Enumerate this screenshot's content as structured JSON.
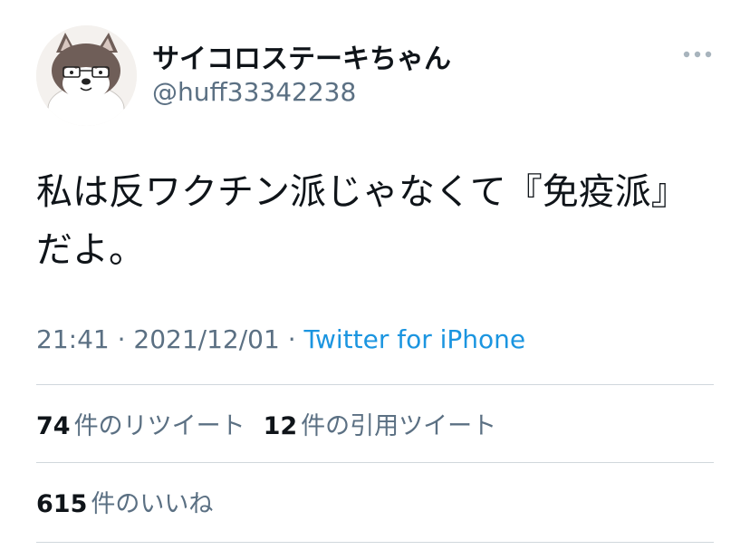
{
  "author": {
    "display_name": "サイコロステーキちゃん",
    "handle": "@huff33342238",
    "avatar_icon": "shiba-dog-with-glasses-avatar"
  },
  "tweet": {
    "text": "私は反ワクチン派じゃなくて『免疫派』だよ。"
  },
  "meta": {
    "time": "21:41",
    "separator1": " · ",
    "date": "2021/12/01",
    "separator2": " · ",
    "source": "Twitter for iPhone"
  },
  "stats": {
    "retweets_count": "74",
    "retweets_label": "件のリツイート",
    "quotes_count": "12",
    "quotes_label": "件の引用ツイート",
    "likes_count": "615",
    "likes_label": "件のいいね"
  },
  "colors": {
    "text_primary": "#0f1419",
    "text_secondary": "#5b7083",
    "link": "#1b95e0",
    "divider": "#d0d7dc"
  },
  "icons": {
    "more": "more-options-icon"
  }
}
